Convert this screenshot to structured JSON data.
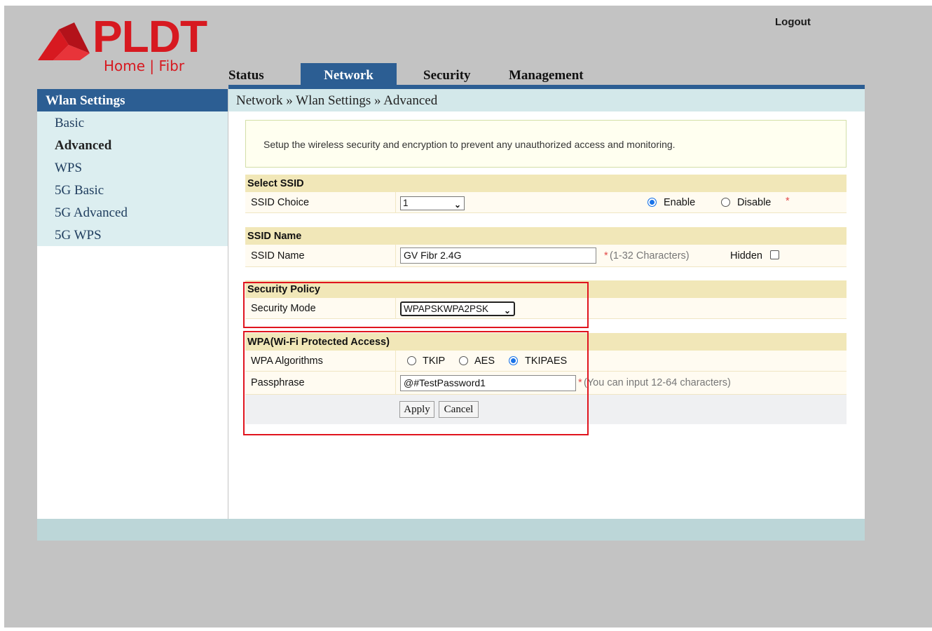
{
  "brand": {
    "name": "PLDT",
    "sub": "Home | Fibr"
  },
  "header": {
    "logout": "Logout",
    "tabs": [
      {
        "label": "Status"
      },
      {
        "label": "Network"
      },
      {
        "label": "Security"
      },
      {
        "label": "Management"
      }
    ],
    "active_tab": "Network"
  },
  "sidebar": {
    "title": "Wlan Settings",
    "items": [
      {
        "label": "Basic"
      },
      {
        "label": "Advanced"
      },
      {
        "label": "WPS"
      },
      {
        "label": "5G Basic"
      },
      {
        "label": "5G Advanced"
      },
      {
        "label": "5G WPS"
      }
    ],
    "active_item": "Advanced"
  },
  "breadcrumb": "Network » Wlan Settings » Advanced",
  "info_text": "Setup the wireless security and encryption to prevent any unauthorized access and monitoring.",
  "select_ssid": {
    "header": "Select SSID",
    "label": "SSID Choice",
    "value": "1",
    "enable_label": "Enable",
    "disable_label": "Disable",
    "required_mark": "*",
    "selected": "Enable"
  },
  "ssid_name": {
    "header": "SSID Name",
    "label": "SSID Name",
    "value": "GV Fibr 2.4G",
    "required_mark": "*",
    "hint": "(1-32 Characters)",
    "hidden_label": "Hidden",
    "hidden_checked": false
  },
  "security_policy": {
    "header": "Security Policy",
    "label": "Security Mode",
    "value": "WPAPSKWPA2PSK"
  },
  "wpa": {
    "header": "WPA(Wi-Fi Protected Access)",
    "algorithms_label": "WPA Algorithms",
    "options": [
      {
        "label": "TKIP"
      },
      {
        "label": "AES"
      },
      {
        "label": "TKIPAES"
      }
    ],
    "selected": "TKIPAES",
    "passphrase_label": "Passphrase",
    "passphrase_value": "@#TestPassword1",
    "required_mark": "*",
    "passphrase_hint": "(You can input 12-64 characters)"
  },
  "buttons": {
    "apply": "Apply",
    "cancel": "Cancel"
  },
  "colors": {
    "nav_blue": "#2c5e93",
    "brand_red": "#d71920",
    "highlight_red": "#e0141e"
  }
}
